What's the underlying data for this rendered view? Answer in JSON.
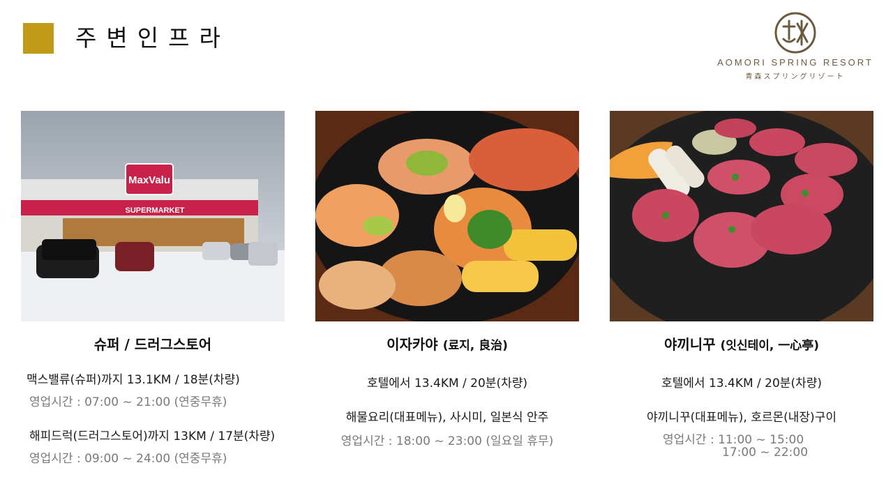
{
  "page": {
    "title": "주변인프라"
  },
  "logo": {
    "name_en": "AOMORI SPRING RESORT",
    "name_jp": "青森スプリングリゾート"
  },
  "photos": [
    {
      "sign_brand": "MaxValu",
      "sign_type": "SUPERMARKET"
    },
    {},
    {}
  ],
  "sections": [
    {
      "heading": "슈퍼 / 드러그스토어",
      "lines": [
        "맥스밸류(슈퍼)까지 13.1KM / 18분(차량)",
        "영업시간 : 07:00 ~ 21:00 (연중무휴)",
        "해피드럭(드러그스토어)까지 13KM / 17분(차량)",
        "영업시간 : 09:00 ~ 24:00 (연중무휴)"
      ]
    },
    {
      "heading": "이자카야",
      "heading_sub": "(료지, 良治)",
      "lines": [
        "호텔에서 13.4KM / 20분(차량)",
        "해물요리(대표메뉴), 사시미, 일본식 안주",
        "영업시간 : 18:00 ~ 23:00 (일요일 휴무)"
      ]
    },
    {
      "heading": "야끼니꾸",
      "heading_sub": "(잇신테이, 一心亭)",
      "lines": [
        "호텔에서 13.4KM / 20분(차량)",
        "야끼니꾸(대표메뉴), 호르몬(내장)구이",
        "영업시간 : 11:00 ~ 15:00",
        "17:00 ~ 22:00"
      ]
    }
  ],
  "colors": {
    "accent": "#C19A17",
    "logo": "#6b5a3e",
    "muted_text": "#7a7a7a"
  }
}
